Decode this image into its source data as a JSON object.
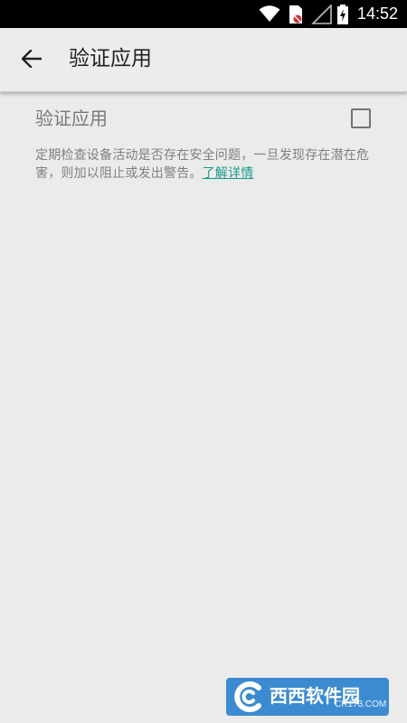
{
  "status_bar": {
    "time": "14:52",
    "icons": [
      "wifi-icon",
      "sim-icon",
      "signal-icon",
      "battery-charging-icon"
    ]
  },
  "app_bar": {
    "title": "验证应用",
    "back_icon": "arrow-left-icon"
  },
  "setting": {
    "title": "验证应用",
    "checked": false,
    "summary": "定期检查设备活动是否存在安全问题，一旦发现存在潜在危害，则加以阻止或发出警告。",
    "link_label": "了解详情"
  },
  "watermark": {
    "text": "西西软件园",
    "url": "CR173.COM"
  },
  "colors": {
    "background": "#ebebeb",
    "status_bar": "#000000",
    "link": "#199a8c",
    "watermark": "#3c8bd0"
  }
}
